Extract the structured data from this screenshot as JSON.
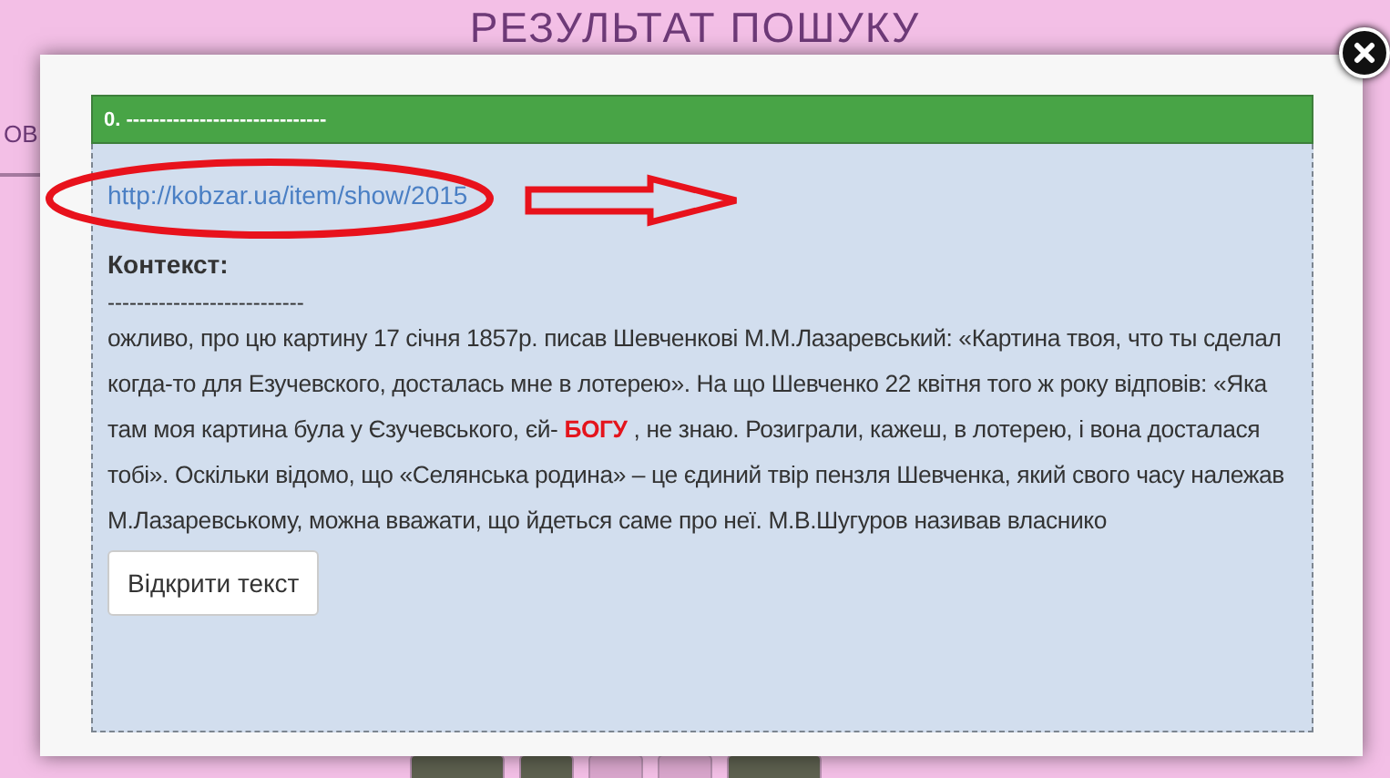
{
  "page": {
    "title": "РЕЗУЛЬТАТ ПОШУКУ",
    "nav_fragment": "ОВ"
  },
  "modal": {
    "header": "0. ------------------------------",
    "link": "http://kobzar.ua/item/show/2015",
    "context_label": "Контекст:",
    "separator": "---------------------------",
    "excerpt": "ожливо, про цю картину 17 січня 1857р. писав Шевченкові М.М.Лазаревський: «Картина твоя, что ты сделал когда-то для Езучевского, досталась мне в лотерею». На що Шевченко 22 квітня того ж року відповів: «Яка там моя картина була у Єзучевського, єй- **БОГУ** , не знаю. Розиграли, кажеш, в лотерею, і вона досталася тобі». Оскільки відомо, що «Селянська родина» – це єдиний твір пензля Шевченка, який свого часу належав М.Лазаревському, можна вважати, що йдеться саме про неї. М.В.Шугуров називав власнико",
    "open_button": "Відкрити текст"
  }
}
